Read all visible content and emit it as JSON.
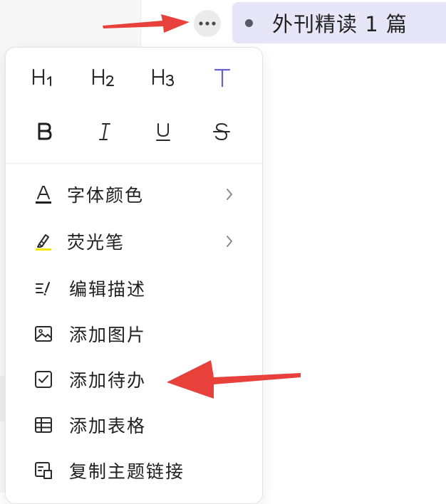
{
  "topic": {
    "text": "外刊精读 1 篇"
  },
  "toolbar": {
    "more_icon": "more-horizontal-icon"
  },
  "format_buttons": {
    "row1": [
      {
        "icon": "heading-1-icon"
      },
      {
        "icon": "heading-2-icon"
      },
      {
        "icon": "heading-3-icon"
      },
      {
        "icon": "text-style-icon",
        "color": "#6b5fd0"
      }
    ],
    "row2": [
      {
        "icon": "bold-icon"
      },
      {
        "icon": "italic-icon"
      },
      {
        "icon": "underline-icon"
      },
      {
        "icon": "strikethrough-icon"
      }
    ]
  },
  "menu": {
    "items": [
      {
        "label": "字体颜色",
        "icon": "font-color-icon",
        "has_submenu": true
      },
      {
        "label": "荧光笔",
        "icon": "highlighter-icon",
        "has_submenu": true
      },
      {
        "label": "编辑描述",
        "icon": "edit-description-icon",
        "has_submenu": false
      },
      {
        "label": "添加图片",
        "icon": "image-icon",
        "has_submenu": false
      },
      {
        "label": "添加待办",
        "icon": "todo-checkbox-icon",
        "has_submenu": false
      },
      {
        "label": "添加表格",
        "icon": "table-icon",
        "has_submenu": false
      },
      {
        "label": "复制主题链接",
        "icon": "copy-link-icon",
        "has_submenu": false
      }
    ]
  },
  "colors": {
    "accent": "#6b5fd0",
    "highlight": "#f2e600",
    "topic_background": "#e6e6f8",
    "annotation_arrow": "#e8413c"
  }
}
